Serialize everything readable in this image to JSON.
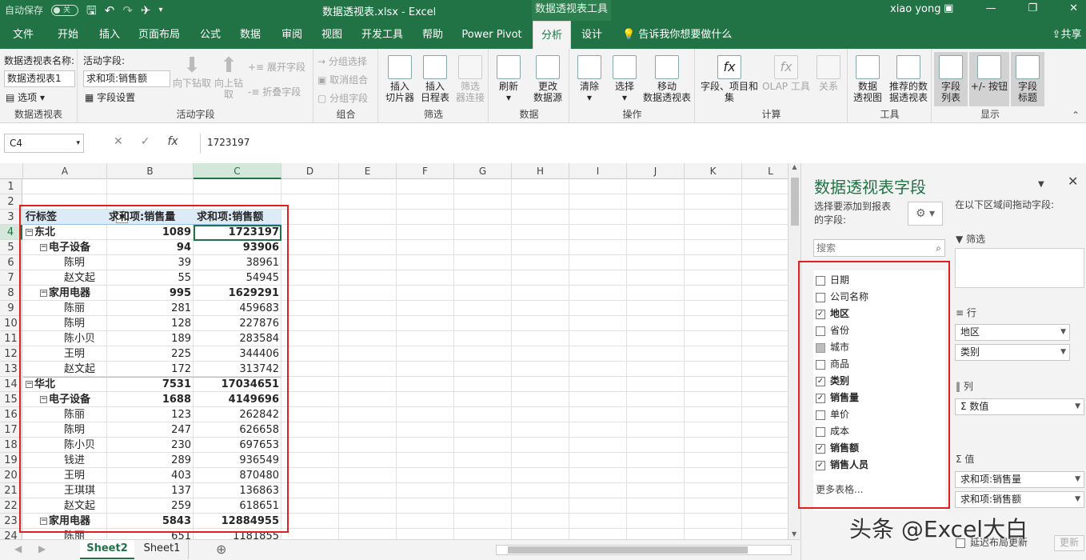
{
  "titlebar": {
    "autosave_label": "自动保存",
    "autosave_state": "关",
    "filename": "数据透视表.xlsx  -  Excel",
    "context_tool": "数据透视表工具",
    "user": "xiao yong"
  },
  "tabs": [
    "文件",
    "开始",
    "插入",
    "页面布局",
    "公式",
    "数据",
    "审阅",
    "视图",
    "开发工具",
    "帮助",
    "Power Pivot",
    "分析",
    "设计",
    "告诉我你想要做什么",
    "共享"
  ],
  "active_tab": "分析",
  "ribbon": {
    "pivot": {
      "name_label": "数据透视表名称:",
      "name_value": "数据透视表1",
      "options": "选项",
      "group": "数据透视表"
    },
    "active_field": {
      "label": "活动字段:",
      "value": "求和项:销售额",
      "settings": "字段设置",
      "drill_down": "向下钻取",
      "drill_up": "向上钻取",
      "expand": "展开字段",
      "collapse": "折叠字段",
      "group": "活动字段"
    },
    "grouping": {
      "group_sel": "分组选择",
      "ungroup": "取消组合",
      "group_field": "分组字段",
      "group": "组合"
    },
    "filter": {
      "slicer": "插入\n切片器",
      "timeline": "插入\n日程表",
      "filter_conn": "筛选\n器连接",
      "group": "筛选"
    },
    "data": {
      "refresh": "刷新",
      "change_source": "更改\n数据源",
      "group": "数据"
    },
    "actions": {
      "clear": "清除",
      "select": "选择",
      "move": "移动\n数据透视表",
      "group": "操作"
    },
    "calc": {
      "fields_items": "字段、项目和\n集",
      "olap": "OLAP 工具",
      "relations": "关系",
      "group": "计算"
    },
    "tools": {
      "chart": "数据\n透视图",
      "recommended": "推荐的数\n据透视表",
      "group": "工具"
    },
    "show": {
      "field_list": "字段\n列表",
      "buttons": "+/- 按钮",
      "headers": "字段\n标题",
      "group": "显示"
    }
  },
  "formula_bar": {
    "name_box": "C4",
    "formula": "1723197"
  },
  "columns": [
    "A",
    "B",
    "C",
    "D",
    "E",
    "F",
    "G",
    "H",
    "I",
    "J",
    "K",
    "L"
  ],
  "rows": [
    "1",
    "2",
    "3",
    "4",
    "5",
    "6",
    "7",
    "8",
    "9",
    "10",
    "11",
    "12",
    "13",
    "14",
    "15",
    "16",
    "17",
    "18",
    "19",
    "20",
    "21",
    "22",
    "23",
    "24"
  ],
  "pivot_table": {
    "headers": [
      "行标签",
      "求和项:销售量",
      "求和项:销售额"
    ],
    "rows": [
      {
        "label": "东北",
        "qty": "1089",
        "amt": "1723197",
        "level": 0
      },
      {
        "label": "电子设备",
        "qty": "94",
        "amt": "93906",
        "level": 1
      },
      {
        "label": "陈明",
        "qty": "39",
        "amt": "38961",
        "level": 2
      },
      {
        "label": "赵文起",
        "qty": "55",
        "amt": "54945",
        "level": 2
      },
      {
        "label": "家用电器",
        "qty": "995",
        "amt": "1629291",
        "level": 1
      },
      {
        "label": "陈丽",
        "qty": "281",
        "amt": "459683",
        "level": 2
      },
      {
        "label": "陈明",
        "qty": "128",
        "amt": "227876",
        "level": 2
      },
      {
        "label": "陈小贝",
        "qty": "189",
        "amt": "283584",
        "level": 2
      },
      {
        "label": "王明",
        "qty": "225",
        "amt": "344406",
        "level": 2
      },
      {
        "label": "赵文起",
        "qty": "172",
        "amt": "313742",
        "level": 2
      },
      {
        "label": "华北",
        "qty": "7531",
        "amt": "17034651",
        "level": 0
      },
      {
        "label": "电子设备",
        "qty": "1688",
        "amt": "4149696",
        "level": 1
      },
      {
        "label": "陈丽",
        "qty": "123",
        "amt": "262842",
        "level": 2
      },
      {
        "label": "陈明",
        "qty": "247",
        "amt": "626658",
        "level": 2
      },
      {
        "label": "陈小贝",
        "qty": "230",
        "amt": "697653",
        "level": 2
      },
      {
        "label": "钱进",
        "qty": "289",
        "amt": "936549",
        "level": 2
      },
      {
        "label": "王明",
        "qty": "403",
        "amt": "870480",
        "level": 2
      },
      {
        "label": "王琪琪",
        "qty": "137",
        "amt": "136863",
        "level": 2
      },
      {
        "label": "赵文起",
        "qty": "259",
        "amt": "618651",
        "level": 2
      },
      {
        "label": "家用电器",
        "qty": "5843",
        "amt": "12884955",
        "level": 1
      },
      {
        "label": "陈丽",
        "qty": "651",
        "amt": "1181855",
        "level": 2
      }
    ]
  },
  "sheets": [
    "Sheet2",
    "Sheet1"
  ],
  "active_sheet": "Sheet2",
  "field_pane": {
    "title": "数据透视表字段",
    "choose_label": "选择要添加到报表\n的字段:",
    "drag_label": "在以下区域间拖动字段:",
    "search_placeholder": "搜索",
    "fields": [
      {
        "name": "日期",
        "checked": false
      },
      {
        "name": "公司名称",
        "checked": false
      },
      {
        "name": "地区",
        "checked": true
      },
      {
        "name": "省份",
        "checked": false
      },
      {
        "name": "城市",
        "checked": false,
        "gray": true
      },
      {
        "name": "商品",
        "checked": false
      },
      {
        "name": "类别",
        "checked": true
      },
      {
        "name": "销售量",
        "checked": true
      },
      {
        "name": "单价",
        "checked": false
      },
      {
        "name": "成本",
        "checked": false
      },
      {
        "name": "销售额",
        "checked": true
      },
      {
        "name": "销售人员",
        "checked": true
      }
    ],
    "more_tables": "更多表格...",
    "areas": {
      "filter": "筛选",
      "rows": "行",
      "columns": "列",
      "values": "值"
    },
    "row_fields": [
      "地区",
      "类别"
    ],
    "column_fields": [
      "Σ 数值"
    ],
    "value_fields": [
      "求和项:销售量",
      "求和项:销售额"
    ],
    "defer_label": "延迟布局更新",
    "update_label": "更新"
  },
  "watermark": "头条 @Excel大白"
}
